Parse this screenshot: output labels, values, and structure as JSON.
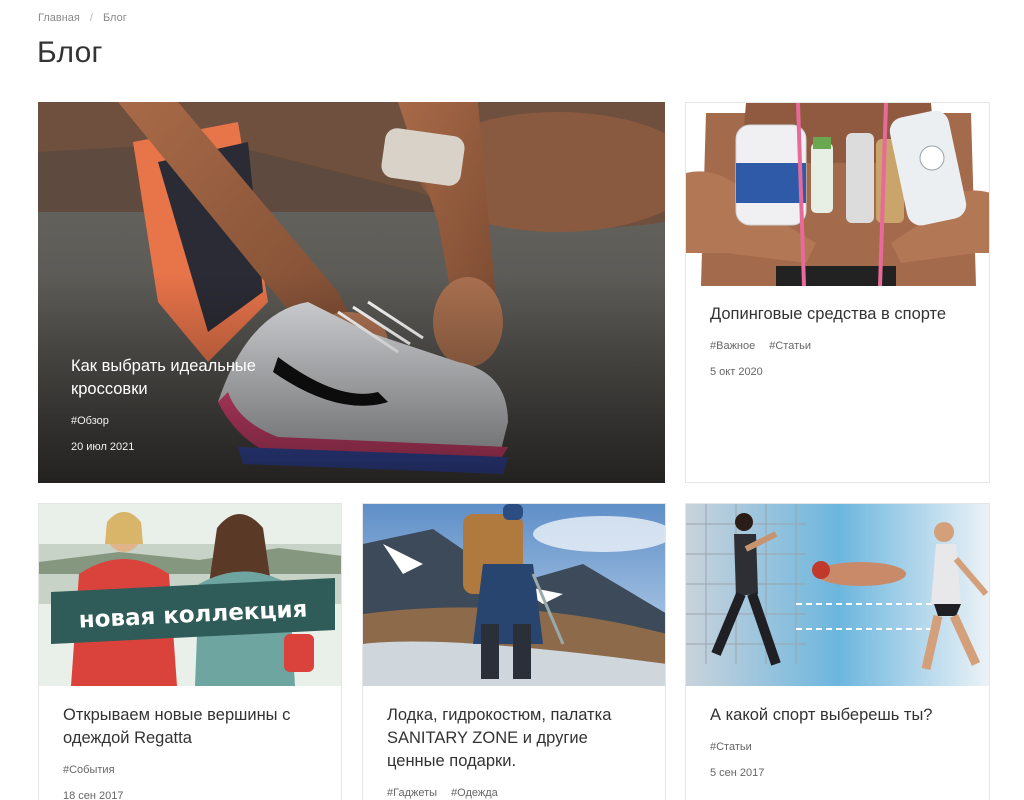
{
  "breadcrumb": {
    "home": "Главная",
    "separator": "/",
    "current": "Блог"
  },
  "page": {
    "title": "Блог"
  },
  "posts": [
    {
      "title": "Как выбрать идеальные кроссовки",
      "tags": [
        "#Обзор"
      ],
      "date": "20 июл 2021",
      "image": "sneaker-lacing-photo"
    },
    {
      "title": "Допинговые средства в спорте",
      "tags": [
        "#Важное",
        "#Статьи"
      ],
      "date": "5 окт 2020",
      "image": "supplements-photo"
    },
    {
      "title": "Открываем новые вершины с одеждой Regatta",
      "tags": [
        "#События"
      ],
      "date": "18 сен 2017",
      "image": "regatta-collection-photo",
      "banner": "новая коллекция"
    },
    {
      "title": "Лодка, гидрокостюм, палатка SANITARY ZONE и другие ценные подарки.",
      "tags": [
        "#Гаджеты",
        "#Одежда"
      ],
      "date": "",
      "image": "hiker-mountains-photo"
    },
    {
      "title": "А какой спорт выберешь ты?",
      "tags": [
        "#Статьи"
      ],
      "date": "5 сен 2017",
      "image": "sports-collage-photo"
    }
  ]
}
